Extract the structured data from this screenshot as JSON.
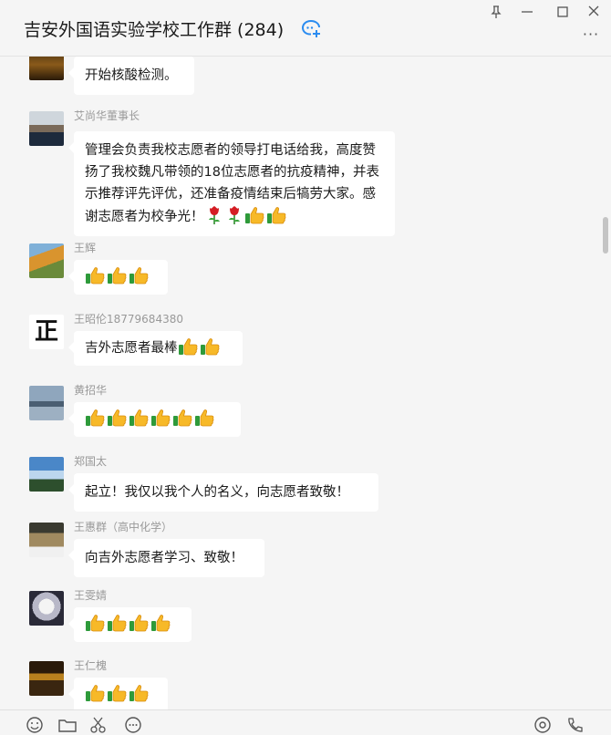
{
  "window": {
    "title": "吉安外国语实验学校工作群 (284)",
    "pin_icon": "pin-icon",
    "minimize_icon": "minimize-icon",
    "maximize_icon": "maximize-icon",
    "close_icon": "close-icon",
    "more_label": "···"
  },
  "messages": [
    {
      "sender": "",
      "text": "开始核酸检测。"
    },
    {
      "sender": "艾尚华董事长",
      "text": "管理会负责我校志愿者的领导打电话给我，高度赞扬了我校魏凡带领的18位志愿者的抗疫精神，并表示推荐评先评优，还准备疫情结束后犒劳大家。感谢志愿者为校争光！",
      "emojis": [
        "rose",
        "rose",
        "thumbs-up",
        "thumbs-up"
      ]
    },
    {
      "sender": "王辉",
      "text": "",
      "emojis": [
        "thumbs-up",
        "thumbs-up",
        "thumbs-up"
      ]
    },
    {
      "sender": "王昭伦18779684380",
      "avatar_text": "正",
      "text": "吉外志愿者最棒",
      "emojis": [
        "thumbs-up",
        "thumbs-up"
      ]
    },
    {
      "sender": "黄招华",
      "text": "",
      "emojis": [
        "thumbs-up",
        "thumbs-up",
        "thumbs-up",
        "thumbs-up",
        "thumbs-up",
        "thumbs-up"
      ]
    },
    {
      "sender": "郑国太",
      "text": "起立！我仅以我个人的名义，向志愿者致敬！"
    },
    {
      "sender": "王惠群（高中化学）",
      "text": "向吉外志愿者学习、致敬！"
    },
    {
      "sender": "王雯婧",
      "text": "",
      "emojis": [
        "thumbs-up",
        "thumbs-up",
        "thumbs-up",
        "thumbs-up"
      ]
    },
    {
      "sender": "王仁槐",
      "text": "",
      "emojis": [
        "thumbs-up",
        "thumbs-up",
        "thumbs-up"
      ]
    }
  ],
  "toolbar": {
    "icons": [
      "emoji-icon",
      "folder-icon",
      "scissors-icon",
      "chat-bubble-icon",
      "live-icon",
      "video-call-icon"
    ]
  },
  "colors": {
    "accent": "#2b8cf0",
    "background": "#f5f5f5",
    "bubble": "#ffffff"
  }
}
